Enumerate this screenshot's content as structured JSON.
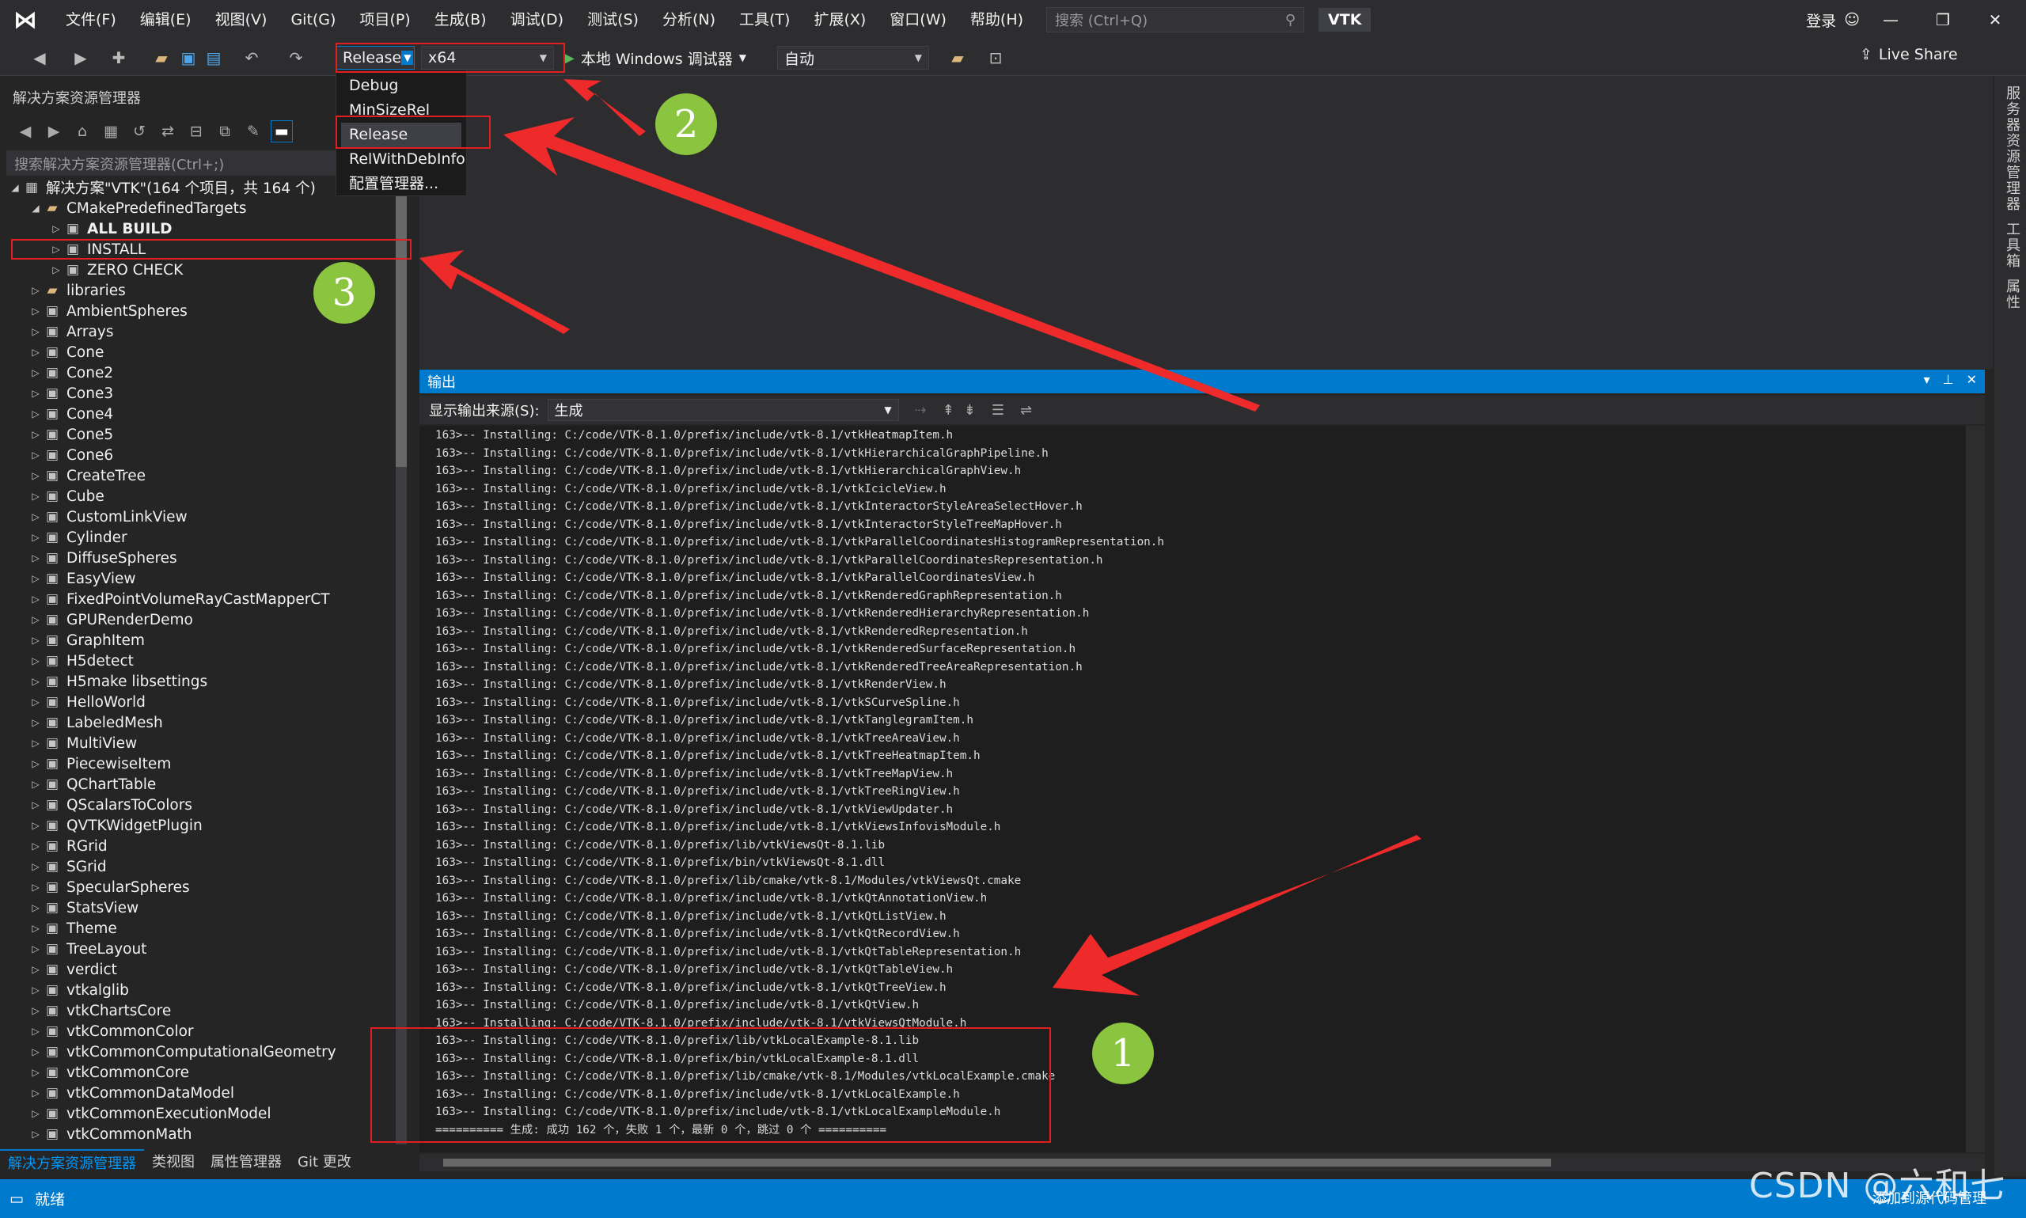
{
  "titlebar": {
    "menu": [
      "文件(F)",
      "编辑(E)",
      "视图(V)",
      "Git(G)",
      "项目(P)",
      "生成(B)",
      "调试(D)",
      "测试(S)",
      "分析(N)",
      "工具(T)",
      "扩展(X)",
      "窗口(W)",
      "帮助(H)"
    ],
    "search_placeholder": "搜索 (Ctrl+Q)",
    "solution_name": "VTK",
    "login_label": "登录"
  },
  "toolbar": {
    "config_value": "Release",
    "platform_value": "x64",
    "debugger_label": "本地 Windows 调试器",
    "auto_value": "自动",
    "liveshare_label": "Live Share"
  },
  "config_dropdown": [
    "Debug",
    "MinSizeRel",
    "Release",
    "RelWithDebInfo",
    "配置管理器..."
  ],
  "solution_explorer": {
    "title": "解决方案资源管理器",
    "search_placeholder": "搜索解决方案资源管理器(Ctrl+;)",
    "tabs": [
      "解决方案资源管理器",
      "类视图",
      "属性管理器",
      "Git 更改"
    ],
    "root_label": "解决方案\"VTK\"(164 个项目，共 164 个)",
    "items": [
      {
        "label": "CMakePredefinedTargets",
        "level": 1,
        "expanded": true,
        "folder": true,
        "bold": false
      },
      {
        "label": "ALL BUILD",
        "level": 2,
        "bold": true
      },
      {
        "label": "INSTALL",
        "level": 2,
        "bold": false
      },
      {
        "label": "ZERO CHECK",
        "level": 2,
        "bold": false
      },
      {
        "label": "libraries",
        "level": 1,
        "folder": true
      },
      {
        "label": "AmbientSpheres",
        "level": 1
      },
      {
        "label": "Arrays",
        "level": 1
      },
      {
        "label": "Cone",
        "level": 1
      },
      {
        "label": "Cone2",
        "level": 1
      },
      {
        "label": "Cone3",
        "level": 1
      },
      {
        "label": "Cone4",
        "level": 1
      },
      {
        "label": "Cone5",
        "level": 1
      },
      {
        "label": "Cone6",
        "level": 1
      },
      {
        "label": "CreateTree",
        "level": 1
      },
      {
        "label": "Cube",
        "level": 1
      },
      {
        "label": "CustomLinkView",
        "level": 1
      },
      {
        "label": "Cylinder",
        "level": 1
      },
      {
        "label": "DiffuseSpheres",
        "level": 1
      },
      {
        "label": "EasyView",
        "level": 1
      },
      {
        "label": "FixedPointVolumeRayCastMapperCT",
        "level": 1
      },
      {
        "label": "GPURenderDemo",
        "level": 1
      },
      {
        "label": "GraphItem",
        "level": 1
      },
      {
        "label": "H5detect",
        "level": 1
      },
      {
        "label": "H5make libsettings",
        "level": 1
      },
      {
        "label": "HelloWorld",
        "level": 1
      },
      {
        "label": "LabeledMesh",
        "level": 1
      },
      {
        "label": "MultiView",
        "level": 1
      },
      {
        "label": "PiecewiseItem",
        "level": 1
      },
      {
        "label": "QChartTable",
        "level": 1
      },
      {
        "label": "QScalarsToColors",
        "level": 1
      },
      {
        "label": "QVTKWidgetPlugin",
        "level": 1
      },
      {
        "label": "RGrid",
        "level": 1
      },
      {
        "label": "SGrid",
        "level": 1
      },
      {
        "label": "SpecularSpheres",
        "level": 1
      },
      {
        "label": "StatsView",
        "level": 1
      },
      {
        "label": "Theme",
        "level": 1
      },
      {
        "label": "TreeLayout",
        "level": 1
      },
      {
        "label": "verdict",
        "level": 1
      },
      {
        "label": "vtkalglib",
        "level": 1
      },
      {
        "label": "vtkChartsCore",
        "level": 1
      },
      {
        "label": "vtkCommonColor",
        "level": 1
      },
      {
        "label": "vtkCommonComputationalGeometry",
        "level": 1
      },
      {
        "label": "vtkCommonCore",
        "level": 1
      },
      {
        "label": "vtkCommonDataModel",
        "level": 1
      },
      {
        "label": "vtkCommonExecutionModel",
        "level": 1
      },
      {
        "label": "vtkCommonMath",
        "level": 1
      }
    ]
  },
  "side_tabs": [
    "服务器资源管理器",
    "工具箱",
    "属性"
  ],
  "output": {
    "title": "输出",
    "source_label": "显示输出来源(S):",
    "source_value": "生成",
    "lines": [
      "163>-- Installing: C:/code/VTK-8.1.0/prefix/include/vtk-8.1/vtkHeatmapItem.h",
      "163>-- Installing: C:/code/VTK-8.1.0/prefix/include/vtk-8.1/vtkHierarchicalGraphPipeline.h",
      "163>-- Installing: C:/code/VTK-8.1.0/prefix/include/vtk-8.1/vtkHierarchicalGraphView.h",
      "163>-- Installing: C:/code/VTK-8.1.0/prefix/include/vtk-8.1/vtkIcicleView.h",
      "163>-- Installing: C:/code/VTK-8.1.0/prefix/include/vtk-8.1/vtkInteractorStyleAreaSelectHover.h",
      "163>-- Installing: C:/code/VTK-8.1.0/prefix/include/vtk-8.1/vtkInteractorStyleTreeMapHover.h",
      "163>-- Installing: C:/code/VTK-8.1.0/prefix/include/vtk-8.1/vtkParallelCoordinatesHistogramRepresentation.h",
      "163>-- Installing: C:/code/VTK-8.1.0/prefix/include/vtk-8.1/vtkParallelCoordinatesRepresentation.h",
      "163>-- Installing: C:/code/VTK-8.1.0/prefix/include/vtk-8.1/vtkParallelCoordinatesView.h",
      "163>-- Installing: C:/code/VTK-8.1.0/prefix/include/vtk-8.1/vtkRenderedGraphRepresentation.h",
      "163>-- Installing: C:/code/VTK-8.1.0/prefix/include/vtk-8.1/vtkRenderedHierarchyRepresentation.h",
      "163>-- Installing: C:/code/VTK-8.1.0/prefix/include/vtk-8.1/vtkRenderedRepresentation.h",
      "163>-- Installing: C:/code/VTK-8.1.0/prefix/include/vtk-8.1/vtkRenderedSurfaceRepresentation.h",
      "163>-- Installing: C:/code/VTK-8.1.0/prefix/include/vtk-8.1/vtkRenderedTreeAreaRepresentation.h",
      "163>-- Installing: C:/code/VTK-8.1.0/prefix/include/vtk-8.1/vtkRenderView.h",
      "163>-- Installing: C:/code/VTK-8.1.0/prefix/include/vtk-8.1/vtkSCurveSpline.h",
      "163>-- Installing: C:/code/VTK-8.1.0/prefix/include/vtk-8.1/vtkTanglegramItem.h",
      "163>-- Installing: C:/code/VTK-8.1.0/prefix/include/vtk-8.1/vtkTreeAreaView.h",
      "163>-- Installing: C:/code/VTK-8.1.0/prefix/include/vtk-8.1/vtkTreeHeatmapItem.h",
      "163>-- Installing: C:/code/VTK-8.1.0/prefix/include/vtk-8.1/vtkTreeMapView.h",
      "163>-- Installing: C:/code/VTK-8.1.0/prefix/include/vtk-8.1/vtkTreeRingView.h",
      "163>-- Installing: C:/code/VTK-8.1.0/prefix/include/vtk-8.1/vtkViewUpdater.h",
      "163>-- Installing: C:/code/VTK-8.1.0/prefix/include/vtk-8.1/vtkViewsInfovisModule.h",
      "163>-- Installing: C:/code/VTK-8.1.0/prefix/lib/vtkViewsQt-8.1.lib",
      "163>-- Installing: C:/code/VTK-8.1.0/prefix/bin/vtkViewsQt-8.1.dll",
      "163>-- Installing: C:/code/VTK-8.1.0/prefix/lib/cmake/vtk-8.1/Modules/vtkViewsQt.cmake",
      "163>-- Installing: C:/code/VTK-8.1.0/prefix/include/vtk-8.1/vtkQtAnnotationView.h",
      "163>-- Installing: C:/code/VTK-8.1.0/prefix/include/vtk-8.1/vtkQtListView.h",
      "163>-- Installing: C:/code/VTK-8.1.0/prefix/include/vtk-8.1/vtkQtRecordView.h",
      "163>-- Installing: C:/code/VTK-8.1.0/prefix/include/vtk-8.1/vtkQtTableRepresentation.h",
      "163>-- Installing: C:/code/VTK-8.1.0/prefix/include/vtk-8.1/vtkQtTableView.h",
      "163>-- Installing: C:/code/VTK-8.1.0/prefix/include/vtk-8.1/vtkQtTreeView.h",
      "163>-- Installing: C:/code/VTK-8.1.0/prefix/include/vtk-8.1/vtkQtView.h",
      "163>-- Installing: C:/code/VTK-8.1.0/prefix/include/vtk-8.1/vtkViewsQtModule.h",
      "163>-- Installing: C:/code/VTK-8.1.0/prefix/lib/vtkLocalExample-8.1.lib",
      "163>-- Installing: C:/code/VTK-8.1.0/prefix/bin/vtkLocalExample-8.1.dll",
      "163>-- Installing: C:/code/VTK-8.1.0/prefix/lib/cmake/vtk-8.1/Modules/vtkLocalExample.cmake",
      "163>-- Installing: C:/code/VTK-8.1.0/prefix/include/vtk-8.1/vtkLocalExample.h",
      "163>-- Installing: C:/code/VTK-8.1.0/prefix/include/vtk-8.1/vtkLocalExampleModule.h",
      "========== 生成: 成功 162 个，失败 1 个，最新 0 个，跳过 0 个 =========="
    ]
  },
  "status": {
    "ready": "就绪",
    "right": "添加到源代码管理"
  },
  "annotations": {
    "badges": [
      "1",
      "2",
      "3"
    ],
    "color": "#e02020",
    "badge_color": "#8bc43f"
  },
  "watermark": "CSDN @六和七"
}
